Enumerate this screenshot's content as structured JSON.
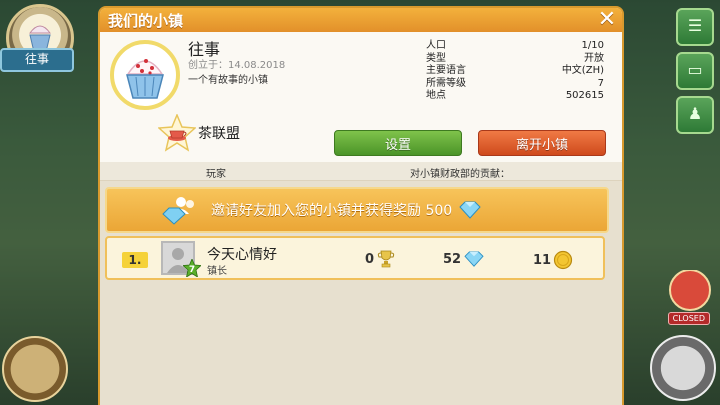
{
  "background": {
    "town_tag": "往事",
    "closed_label": "CLOSED"
  },
  "dialog": {
    "title": "我们的小镇",
    "close_glyph": "✕"
  },
  "town": {
    "name": "往事",
    "created": "创立于：14.08.2018",
    "description": "一个有故事的小镇",
    "stats": [
      {
        "label": "人口",
        "value": "1/10"
      },
      {
        "label": "类型",
        "value": "开放"
      },
      {
        "label": "主要语言",
        "value": "中文(ZH)"
      },
      {
        "label": "所需等级",
        "value": "7"
      },
      {
        "label": "地点",
        "value": "502615"
      }
    ],
    "league": "茶联盟"
  },
  "buttons": {
    "settings": "设置",
    "leave": "离开小镇"
  },
  "columns": {
    "player": "玩家",
    "contribution": "对小镇财政部的贡献："
  },
  "invite": {
    "text": "邀请好友加入您的小镇并获得奖励 500"
  },
  "members": [
    {
      "rank": "1.",
      "name": "今天心情好",
      "role": "镇长",
      "level": "7",
      "trophies": "0",
      "diamonds": "52",
      "coins": "11"
    }
  ],
  "colors": {
    "header": "#e9a031",
    "settings_button": "#5aa534",
    "leave_button": "#e05b2a",
    "invite_bar": "#f0b444"
  }
}
